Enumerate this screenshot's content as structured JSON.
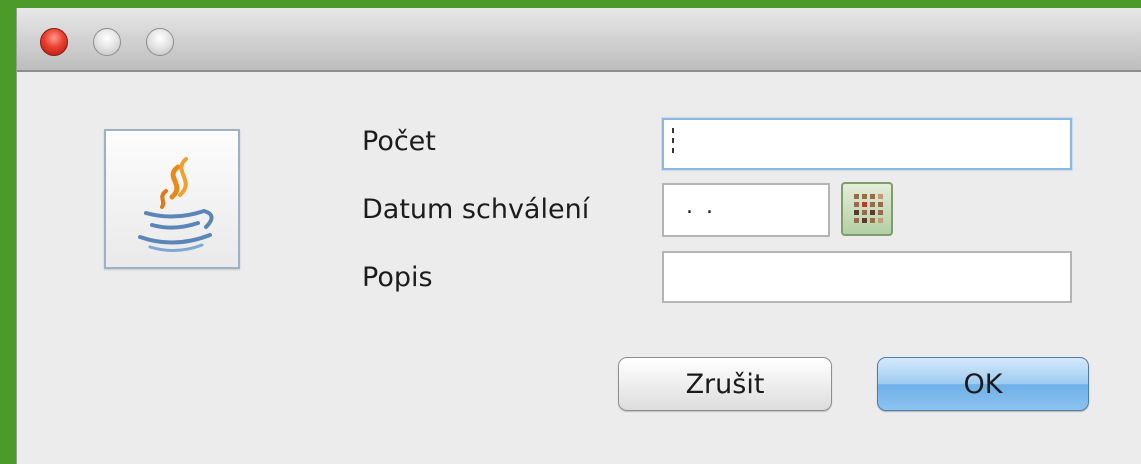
{
  "window": {
    "title": "",
    "controls": [
      "close-icon",
      "minimize-icon",
      "zoom-icon"
    ]
  },
  "icon": {
    "name": "java-coffee-cup-icon"
  },
  "form": {
    "count": {
      "label": "Počet",
      "value": ""
    },
    "approval_date": {
      "label": "Datum schválení",
      "value": ". ."
    },
    "description": {
      "label": "Popis",
      "value": ""
    },
    "calendar_button": {
      "icon": "calendar-icon"
    }
  },
  "buttons": {
    "cancel": "Zrušit",
    "ok": "OK"
  },
  "colors": {
    "background": "#4c9a2a",
    "dialog": "#ececec",
    "ok_button": "#8cc3ef",
    "focus_border": "#8fb6dc"
  }
}
